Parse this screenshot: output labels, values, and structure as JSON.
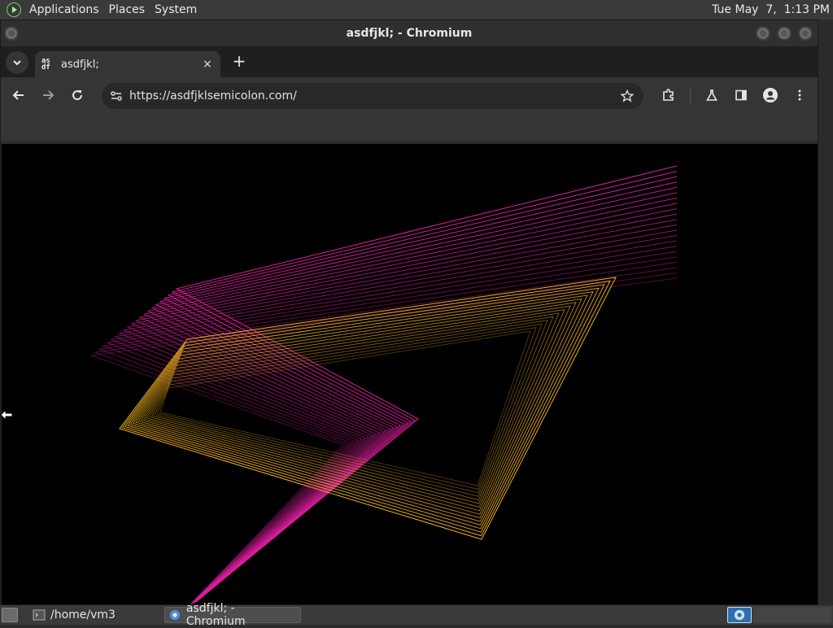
{
  "top_panel": {
    "menus": [
      "Applications",
      "Places",
      "System"
    ],
    "clock": "Tue May  7,  1:13 PM"
  },
  "window": {
    "title": "asdfjkl; - Chromium"
  },
  "tab": {
    "favicon_text_top": "as",
    "favicon_text_bottom": "df",
    "title": "asdfjkl;",
    "close": "×",
    "new_tab": "+"
  },
  "omnibox": {
    "url": "https://asdfjklsemicolon.com/"
  },
  "toolbar_icons": [
    "back-icon",
    "forward-icon",
    "reload-icon",
    "site-info-icon",
    "bookmark-star-icon",
    "extensions-icon",
    "labs-flask-icon",
    "side-panel-icon",
    "profile-icon",
    "kebab-menu-icon"
  ],
  "art": {
    "magenta": "#e01ea0",
    "gold": "#f0b020",
    "background": "#000000"
  },
  "taskbar": {
    "tasks": [
      {
        "label": "/home/vm3"
      },
      {
        "label": "asdfjkl; - Chromium"
      }
    ]
  }
}
